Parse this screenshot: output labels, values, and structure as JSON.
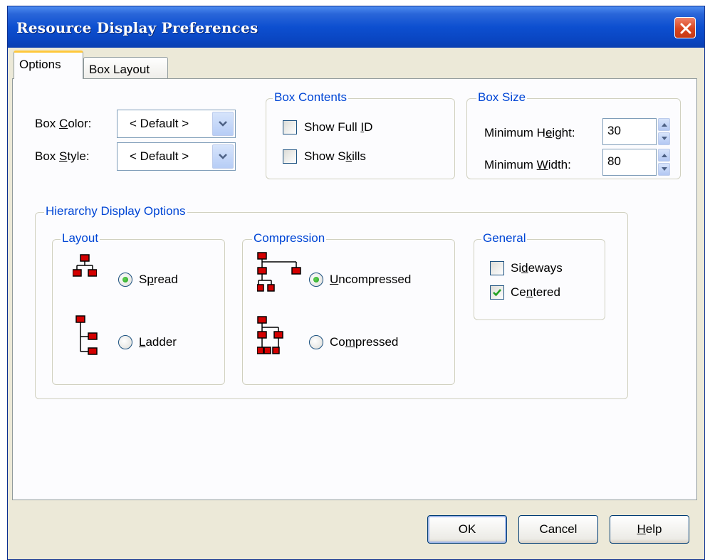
{
  "window": {
    "title": "Resource Display Preferences"
  },
  "tabs": [
    {
      "label": "Options"
    },
    {
      "label": "Box Layout"
    }
  ],
  "box_color": {
    "label_pre": "Box ",
    "label_key": "C",
    "label_post": "olor:",
    "value": "< Default >"
  },
  "box_style": {
    "label_pre": "Box ",
    "label_key": "S",
    "label_post": "tyle:",
    "value": "< Default >"
  },
  "box_contents": {
    "legend": "Box Contents",
    "show_full_id": {
      "pre": "Show Full ",
      "key": "I",
      "post": "D",
      "checked": false
    },
    "show_skills": {
      "pre": "Show S",
      "key": "k",
      "post": "ills",
      "checked": false
    }
  },
  "box_size": {
    "legend": "Box Size",
    "min_height": {
      "pre": "Minimum H",
      "key": "e",
      "post": "ight:",
      "value": "30"
    },
    "min_width": {
      "pre": "Minimum ",
      "key": "W",
      "post": "idth:",
      "value": "80"
    }
  },
  "hierarchy": {
    "legend": "Hierarchy Display Options",
    "layout": {
      "legend": "Layout",
      "spread": {
        "pre": "S",
        "key": "p",
        "post": "read",
        "selected": true
      },
      "ladder": {
        "pre": "",
        "key": "L",
        "post": "adder",
        "selected": false
      }
    },
    "compression": {
      "legend": "Compression",
      "uncompressed": {
        "pre": "",
        "key": "U",
        "post": "ncompressed",
        "selected": true
      },
      "compressed": {
        "pre": "Co",
        "key": "m",
        "post": "pressed",
        "selected": false
      }
    },
    "general": {
      "legend": "General",
      "sideways": {
        "pre": "Si",
        "key": "d",
        "post": "eways",
        "checked": false
      },
      "centered": {
        "pre": "Ce",
        "key": "n",
        "post": "tered",
        "checked": true
      }
    }
  },
  "buttons": {
    "ok": "OK",
    "cancel": "Cancel",
    "help": {
      "pre": "",
      "key": "H",
      "post": "elp"
    }
  },
  "colors": {
    "legend_blue": "#0046d5",
    "node_red": "#d40000",
    "check_green": "#21a121"
  }
}
